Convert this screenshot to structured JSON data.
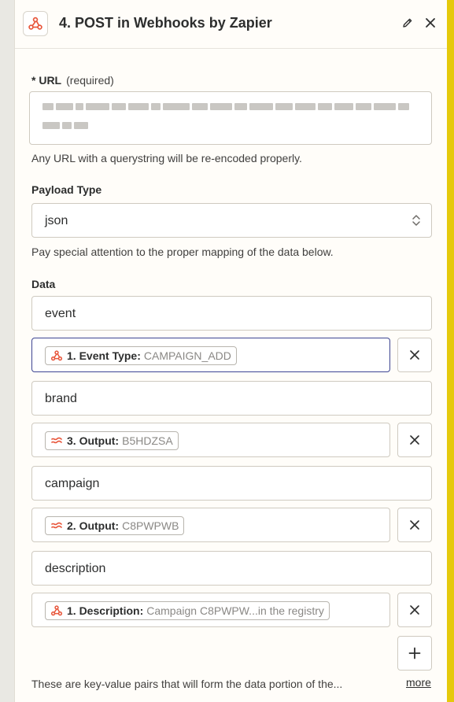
{
  "header": {
    "title": "4. POST in Webhooks by Zapier",
    "app_icon": "webhook-icon",
    "edit_icon": "pencil-icon",
    "close_icon": "close-icon"
  },
  "url_field": {
    "label": "* URL",
    "required_note": "(required)",
    "help": "Any URL with a querystring will be re-encoded properly."
  },
  "payload_type": {
    "label": "Payload Type",
    "value": "json",
    "help": "Pay special attention to the proper mapping of the data below."
  },
  "data": {
    "label": "Data",
    "pairs": [
      {
        "key": "event",
        "pill_label": "1. Event Type:",
        "pill_value": "CAMPAIGN_ADD",
        "pill_icon": "webhook-icon"
      },
      {
        "key": "brand",
        "pill_label": "3. Output:",
        "pill_value": "B5HDZSA",
        "pill_icon": "formatter-icon"
      },
      {
        "key": "campaign",
        "pill_label": "2. Output:",
        "pill_value": "C8PWPWB",
        "pill_icon": "formatter-icon"
      },
      {
        "key": "description",
        "pill_label": "1. Description:",
        "pill_value": "Campaign C8PWPW...in the registry",
        "pill_icon": "webhook-icon"
      }
    ],
    "add_icon": "plus-icon",
    "remove_icon": "close-icon",
    "footer": "These are key-value pairs that will form the data portion of the...",
    "more_link": "more"
  },
  "colors": {
    "accent_orange": "#e8573c",
    "focus_border": "#3d4592",
    "side_strip": "#e5c90b"
  }
}
